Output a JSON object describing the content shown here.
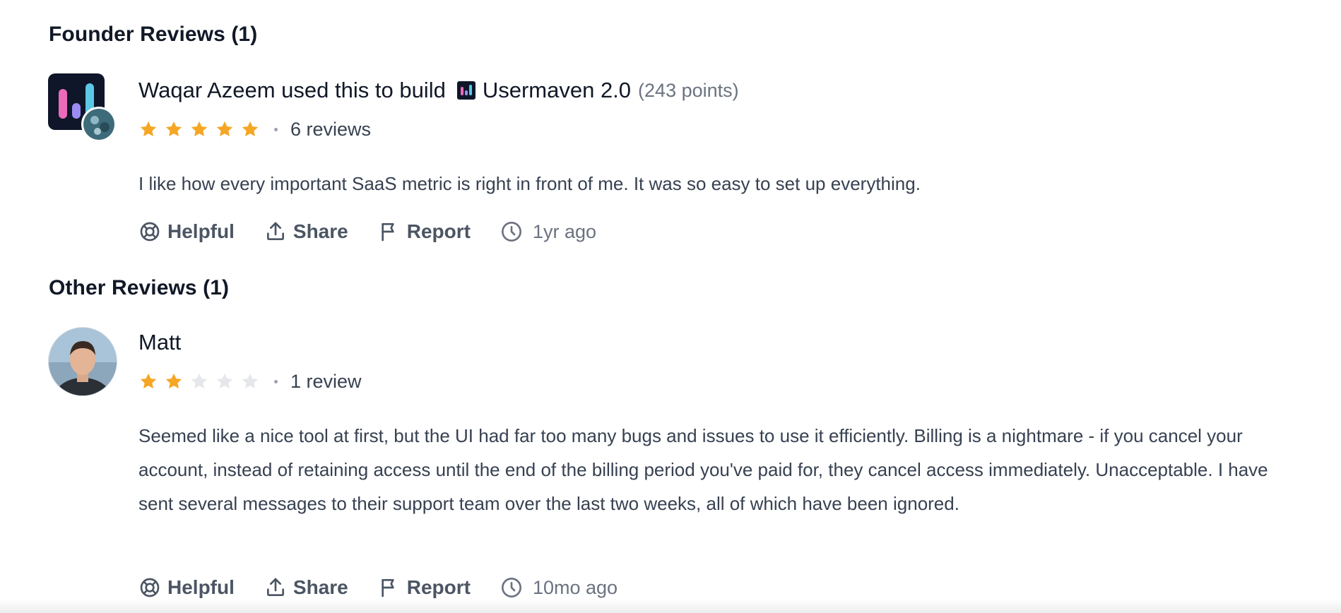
{
  "founder_section": {
    "title": "Founder Reviews (1)",
    "review": {
      "author": "Waqar Azeem",
      "built_text": "used this to build",
      "product": "Usermaven 2.0",
      "points": "(243 points)",
      "rating": 5,
      "reviews_count": "6 reviews",
      "text": "I like how every important SaaS metric is right in front of me. It was so easy to set up everything.",
      "actions": {
        "helpful": "Helpful",
        "share": "Share",
        "report": "Report"
      },
      "time": "1yr ago"
    }
  },
  "other_section": {
    "title": "Other Reviews (1)",
    "review": {
      "author": "Matt",
      "rating": 2,
      "reviews_count": "1 review",
      "text": "Seemed like a nice tool at first, but the UI had far too many bugs and issues to use it efficiently. Billing is a nightmare - if you cancel your account, instead of retaining access until the end of the billing period you've paid for, they cancel access immediately. Unacceptable. I have sent several messages to their support team over the last two weeks, all of which have been ignored.",
      "actions": {
        "helpful": "Helpful",
        "share": "Share",
        "report": "Report"
      },
      "time": "10mo ago"
    }
  },
  "colors": {
    "star_filled": "#f5a623",
    "star_empty": "#e5e7eb",
    "logo_bg": "#0f1629"
  }
}
